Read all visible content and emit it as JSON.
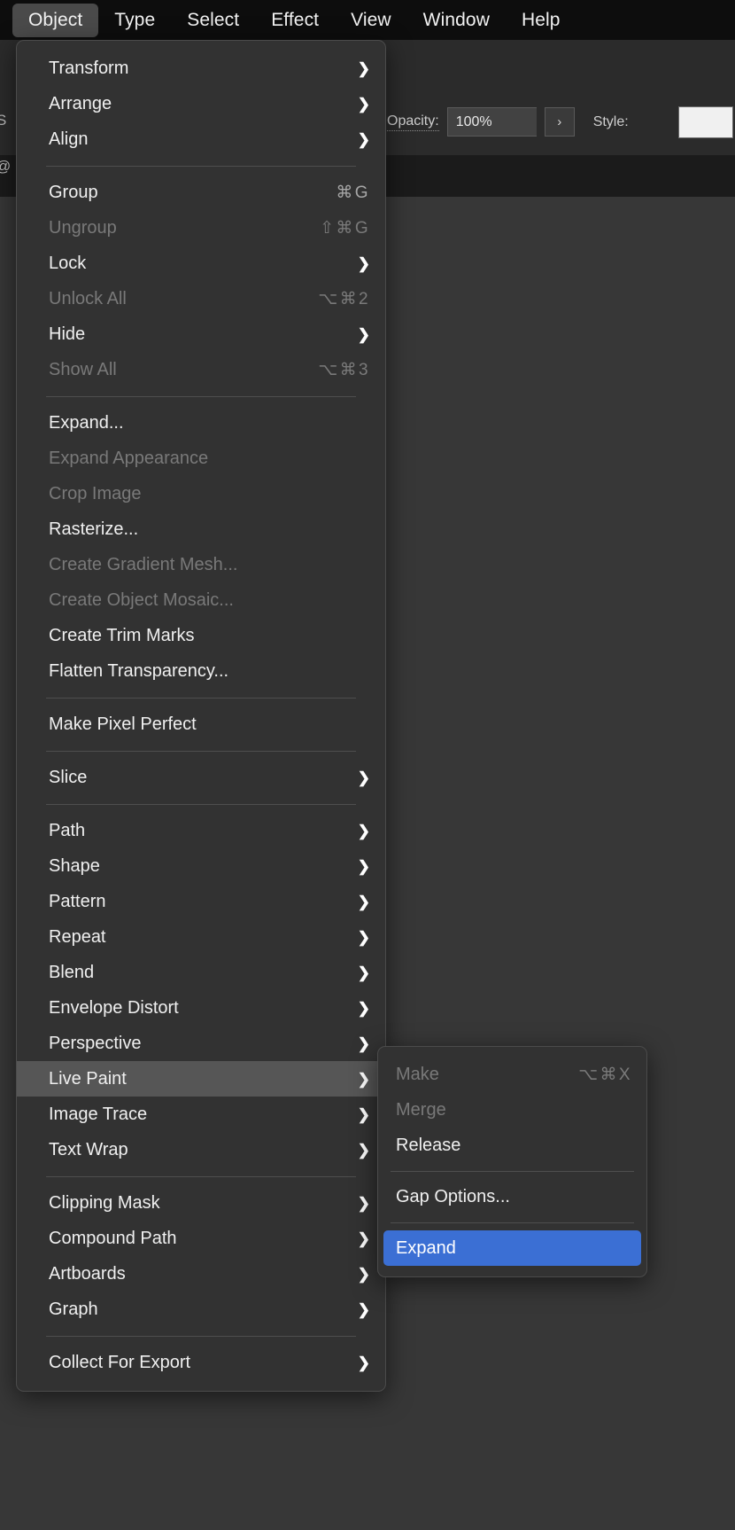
{
  "menubar": {
    "items": [
      {
        "label": "Object",
        "active": true
      },
      {
        "label": "Type",
        "active": false
      },
      {
        "label": "Select",
        "active": false
      },
      {
        "label": "Effect",
        "active": false
      },
      {
        "label": "View",
        "active": false
      },
      {
        "label": "Window",
        "active": false
      },
      {
        "label": "Help",
        "active": false
      }
    ]
  },
  "control_bar": {
    "left_fragment_1": "S",
    "left_fragment_2": "@",
    "opacity_label": "Opacity:",
    "opacity_value": "100%",
    "opacity_stepper_icon": "chevron-right",
    "style_label": "Style:"
  },
  "object_menu": {
    "rows": [
      {
        "type": "item",
        "label": "Transform",
        "shortcut": "",
        "submenu": true,
        "disabled": false,
        "highlight": false
      },
      {
        "type": "item",
        "label": "Arrange",
        "shortcut": "",
        "submenu": true,
        "disabled": false,
        "highlight": false
      },
      {
        "type": "item",
        "label": "Align",
        "shortcut": "",
        "submenu": true,
        "disabled": false,
        "highlight": false
      },
      {
        "type": "separator"
      },
      {
        "type": "item",
        "label": "Group",
        "shortcut": "⌘G",
        "submenu": false,
        "disabled": false,
        "highlight": false
      },
      {
        "type": "item",
        "label": "Ungroup",
        "shortcut": "⇧⌘G",
        "submenu": false,
        "disabled": true,
        "highlight": false
      },
      {
        "type": "item",
        "label": "Lock",
        "shortcut": "",
        "submenu": true,
        "disabled": false,
        "highlight": false
      },
      {
        "type": "item",
        "label": "Unlock All",
        "shortcut": "⌥⌘2",
        "submenu": false,
        "disabled": true,
        "highlight": false
      },
      {
        "type": "item",
        "label": "Hide",
        "shortcut": "",
        "submenu": true,
        "disabled": false,
        "highlight": false
      },
      {
        "type": "item",
        "label": "Show All",
        "shortcut": "⌥⌘3",
        "submenu": false,
        "disabled": true,
        "highlight": false
      },
      {
        "type": "separator"
      },
      {
        "type": "item",
        "label": "Expand...",
        "shortcut": "",
        "submenu": false,
        "disabled": false,
        "highlight": false
      },
      {
        "type": "item",
        "label": "Expand Appearance",
        "shortcut": "",
        "submenu": false,
        "disabled": true,
        "highlight": false
      },
      {
        "type": "item",
        "label": "Crop Image",
        "shortcut": "",
        "submenu": false,
        "disabled": true,
        "highlight": false
      },
      {
        "type": "item",
        "label": "Rasterize...",
        "shortcut": "",
        "submenu": false,
        "disabled": false,
        "highlight": false
      },
      {
        "type": "item",
        "label": "Create Gradient Mesh...",
        "shortcut": "",
        "submenu": false,
        "disabled": true,
        "highlight": false
      },
      {
        "type": "item",
        "label": "Create Object Mosaic...",
        "shortcut": "",
        "submenu": false,
        "disabled": true,
        "highlight": false
      },
      {
        "type": "item",
        "label": "Create Trim Marks",
        "shortcut": "",
        "submenu": false,
        "disabled": false,
        "highlight": false
      },
      {
        "type": "item",
        "label": "Flatten Transparency...",
        "shortcut": "",
        "submenu": false,
        "disabled": false,
        "highlight": false
      },
      {
        "type": "separator"
      },
      {
        "type": "item",
        "label": "Make Pixel Perfect",
        "shortcut": "",
        "submenu": false,
        "disabled": false,
        "highlight": false
      },
      {
        "type": "separator"
      },
      {
        "type": "item",
        "label": "Slice",
        "shortcut": "",
        "submenu": true,
        "disabled": false,
        "highlight": false
      },
      {
        "type": "separator"
      },
      {
        "type": "item",
        "label": "Path",
        "shortcut": "",
        "submenu": true,
        "disabled": false,
        "highlight": false
      },
      {
        "type": "item",
        "label": "Shape",
        "shortcut": "",
        "submenu": true,
        "disabled": false,
        "highlight": false
      },
      {
        "type": "item",
        "label": "Pattern",
        "shortcut": "",
        "submenu": true,
        "disabled": false,
        "highlight": false
      },
      {
        "type": "item",
        "label": "Repeat",
        "shortcut": "",
        "submenu": true,
        "disabled": false,
        "highlight": false
      },
      {
        "type": "item",
        "label": "Blend",
        "shortcut": "",
        "submenu": true,
        "disabled": false,
        "highlight": false
      },
      {
        "type": "item",
        "label": "Envelope Distort",
        "shortcut": "",
        "submenu": true,
        "disabled": false,
        "highlight": false
      },
      {
        "type": "item",
        "label": "Perspective",
        "shortcut": "",
        "submenu": true,
        "disabled": false,
        "highlight": false
      },
      {
        "type": "item",
        "label": "Live Paint",
        "shortcut": "",
        "submenu": true,
        "disabled": false,
        "highlight": true
      },
      {
        "type": "item",
        "label": "Image Trace",
        "shortcut": "",
        "submenu": true,
        "disabled": false,
        "highlight": false
      },
      {
        "type": "item",
        "label": "Text Wrap",
        "shortcut": "",
        "submenu": true,
        "disabled": false,
        "highlight": false
      },
      {
        "type": "separator"
      },
      {
        "type": "item",
        "label": "Clipping Mask",
        "shortcut": "",
        "submenu": true,
        "disabled": false,
        "highlight": false
      },
      {
        "type": "item",
        "label": "Compound Path",
        "shortcut": "",
        "submenu": true,
        "disabled": false,
        "highlight": false
      },
      {
        "type": "item",
        "label": "Artboards",
        "shortcut": "",
        "submenu": true,
        "disabled": false,
        "highlight": false
      },
      {
        "type": "item",
        "label": "Graph",
        "shortcut": "",
        "submenu": true,
        "disabled": false,
        "highlight": false
      },
      {
        "type": "separator"
      },
      {
        "type": "item",
        "label": "Collect For Export",
        "shortcut": "",
        "submenu": true,
        "disabled": false,
        "highlight": false
      }
    ]
  },
  "live_paint_submenu": {
    "rows": [
      {
        "type": "item",
        "label": "Make",
        "shortcut": "⌥⌘X",
        "disabled": true,
        "selected": false
      },
      {
        "type": "item",
        "label": "Merge",
        "shortcut": "",
        "disabled": true,
        "selected": false
      },
      {
        "type": "item",
        "label": "Release",
        "shortcut": "",
        "disabled": false,
        "selected": false
      },
      {
        "type": "separator"
      },
      {
        "type": "item",
        "label": "Gap Options...",
        "shortcut": "",
        "disabled": false,
        "selected": false
      },
      {
        "type": "separator"
      },
      {
        "type": "item",
        "label": "Expand",
        "shortcut": "",
        "disabled": false,
        "selected": true
      }
    ]
  },
  "colors": {
    "menu_bg": "#323232",
    "menu_border": "#4b4b4b",
    "menubar_bg": "#0d0d0d",
    "highlight": "#565656",
    "selection_blue": "#3b6fd4",
    "canvas": "#373737",
    "text": "#f0f0f0",
    "text_disabled": "#797979"
  }
}
